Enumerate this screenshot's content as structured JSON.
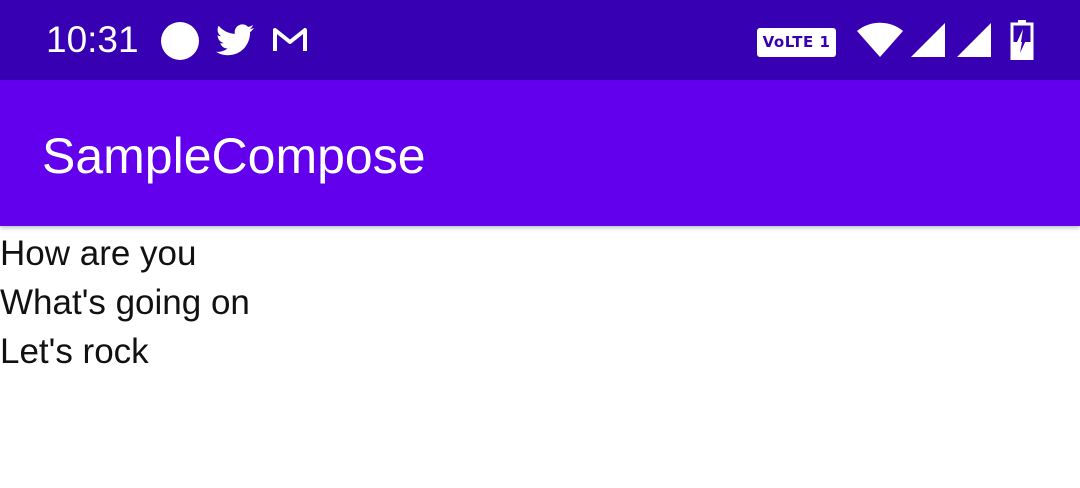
{
  "status_bar": {
    "time": "10:31",
    "network_badge": "VoLTE 1",
    "notification_icons": [
      "circle-icon",
      "twitter-icon",
      "gmail-icon"
    ],
    "system_icons": [
      "wifi-icon",
      "signal-icon",
      "signal-icon",
      "battery-charging-icon"
    ]
  },
  "app_bar": {
    "title": "SampleCompose"
  },
  "messages": [
    "How are you",
    "What's going on",
    "Let's rock"
  ],
  "colors": {
    "status_bar": "#3700B3",
    "app_bar": "#6200EE",
    "title_text": "#FFFFFF",
    "body_text": "#111111",
    "background": "#FFFFFF"
  }
}
